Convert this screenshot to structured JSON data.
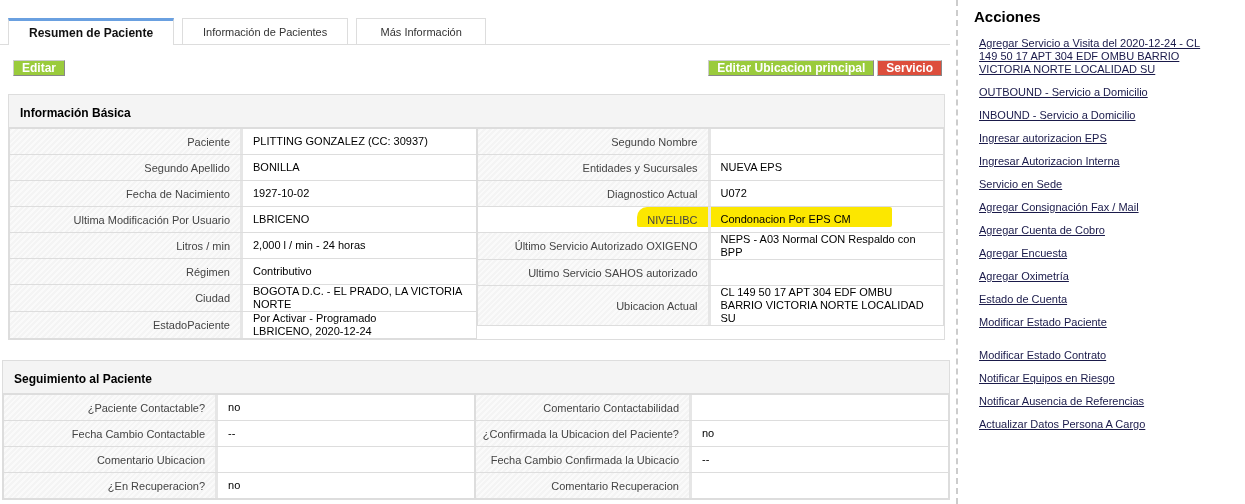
{
  "tabs": [
    {
      "label": "Resumen de Paciente",
      "selected": true
    },
    {
      "label": "Información de Pacientes",
      "selected": false
    },
    {
      "label": "Más Información",
      "selected": false
    }
  ],
  "toolbar": {
    "left_buttons": [
      {
        "label": "Editar",
        "kind": "green"
      }
    ],
    "right_buttons": [
      {
        "label": "Editar Ubicacion principal",
        "kind": "green"
      },
      {
        "label": "Servicio",
        "kind": "red"
      }
    ]
  },
  "basic_info": {
    "title": "Información Básica",
    "left_fields": [
      {
        "label": "Paciente",
        "value": "PLITTING GONZALEZ (CC: 30937)",
        "highlighted": false
      },
      {
        "label": "Segundo Apellido",
        "value": "BONILLA",
        "highlighted": false
      },
      {
        "label": "Fecha de Nacimiento",
        "value": "1927-10-02",
        "highlighted": false
      },
      {
        "label": "Ultima Modificación Por Usuario",
        "value": "LBRICENO",
        "highlighted": false
      },
      {
        "label": "Litros / min",
        "value": "2,000 l / min - 24 horas",
        "highlighted": false
      },
      {
        "label": "Régimen",
        "value": "Contributivo",
        "highlighted": false
      },
      {
        "label": "Ciudad",
        "value": "BOGOTA D.C. - EL PRADO, LA VICTORIA NORTE",
        "highlighted": false
      },
      {
        "label": "EstadoPaciente",
        "value": "Por Activar - Programado\nLBRICENO, 2020-12-24",
        "highlighted": false
      }
    ],
    "right_fields": [
      {
        "label": "Segundo Nombre",
        "highlighted": false
      },
      {
        "label": "Entidades y Sucursales",
        "value": "NUEVA EPS",
        "highlighted": false
      },
      {
        "label": "Diagnostico Actual",
        "value": "U072",
        "highlighted": false
      },
      {
        "label": "NIVELIBC",
        "value": "Condonacion Por EPS CM",
        "highlighted": true
      },
      {
        "label": "Último Servicio Autorizado OXIGENO",
        "value": "NEPS - A03 Normal CON Respaldo con BPP",
        "highlighted": false
      },
      {
        "label": "Ultimo Servicio SAHOS autorizado",
        "highlighted": false
      },
      {
        "label": "Ubicacion Actual",
        "value": "CL 149 50 17 APT 304 EDF OMBU BARRIO VICTORIA NORTE LOCALIDAD SU",
        "highlighted": false
      }
    ]
  },
  "follow_up": {
    "title": "Seguimiento al Paciente",
    "rows": [
      {
        "label_1": "¿Paciente Contactable?",
        "value_1": "no",
        "label_2": "Comentario Contactabilidad"
      },
      {
        "label_1": "Fecha Cambio Contactable",
        "value_1": "--",
        "label_2": "¿Confirmada la Ubicacion del Paciente?",
        "value_2": "no"
      },
      {
        "label_1": "Comentario Ubicacion",
        "label_2": "Fecha Cambio Confirmada la Ubicacio",
        "value_2": "--"
      },
      {
        "label_1": "¿En Recuperacion?",
        "value_1": "no",
        "label_2": "Comentario Recuperacion"
      }
    ]
  },
  "actions": {
    "title": "Acciones",
    "links": [
      {
        "label": "Agregar Servicio a Visita del 2020-12-24 - CL 149 50 17 APT 304 EDF OMBU BARRIO VICTORIA NORTE LOCALIDAD SU"
      },
      {
        "label": "OUTBOUND - Servicio a Domicilio"
      },
      {
        "label": "INBOUND - Servicio a Domicilio"
      },
      {
        "label": "Ingresar autorizacion EPS"
      },
      {
        "label": "Ingresar Autorizacion Interna"
      },
      {
        "label": "Servicio en Sede"
      },
      {
        "label": "Agregar Consignación Fax / Mail"
      },
      {
        "label": "Agregar Cuenta de Cobro"
      },
      {
        "label": "Agregar Encuesta"
      },
      {
        "label": "Agregar Oximetría"
      },
      {
        "label": "Estado de Cuenta"
      },
      {
        "label": "Modificar Estado Paciente"
      },
      {
        "label": "Modificar Estado Contrato"
      },
      {
        "label": "Notificar Equipos en Riesgo"
      },
      {
        "label": "Notificar Ausencia de Referencias"
      },
      {
        "label": "Actualizar Datos Persona A Cargo"
      }
    ]
  }
}
